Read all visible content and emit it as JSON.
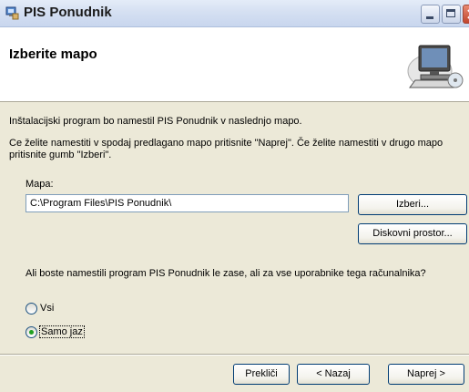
{
  "window": {
    "title": "PIS Ponudnik"
  },
  "header": {
    "title": "Izberite mapo"
  },
  "body": {
    "instruction_1": "Inštalacijski program bo namestil PIS Ponudnik v naslednjo mapo.",
    "instruction_2": "Ce želite namestiti v spodaj predlagano mapo pritisnite \"Naprej\". Če želite namestiti v drugo mapo pritisnite gumb \"Izberi\".",
    "folder_label": "Mapa:",
    "folder_value": "C:\\Program Files\\PIS Ponudnik\\",
    "browse_label": "Izberi...",
    "disk_space_label": "Diskovni prostor...",
    "question": "Ali boste namestili program PIS Ponudnik le zase, ali za vse uporabnike tega računalnika?",
    "radio_all_label": "Vsi",
    "radio_me_label": "Samo jaz",
    "selected_option": "Samo jaz"
  },
  "footer": {
    "cancel_label": "Prekliči",
    "back_label": "< Nazaj",
    "next_label": "Naprej >"
  },
  "icons": {
    "app": "installer-icon",
    "header": "computer-disk-icon",
    "minimize": "minimize-icon",
    "maximize": "maximize-icon",
    "close": "close-icon"
  },
  "colors": {
    "dialog_background": "#ece9d8",
    "header_background": "#ffffff",
    "button_border": "#003c74",
    "radio_selected": "#21a121"
  }
}
